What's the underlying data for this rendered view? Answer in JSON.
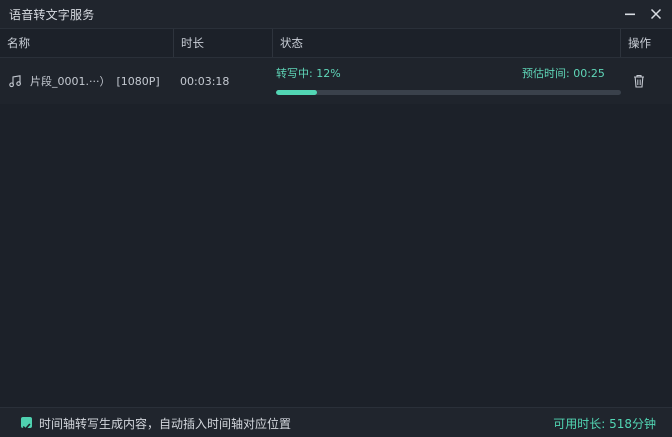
{
  "window": {
    "title": "语音转文字服务"
  },
  "table": {
    "headers": {
      "name": "名称",
      "duration": "时长",
      "status": "状态",
      "action": "操作"
    },
    "rows": [
      {
        "file_name": "片段_0001.···）",
        "resolution": "[1080P]",
        "duration": "00:03:18",
        "status_text": "转写中: 12%",
        "progress_percent": 12,
        "eta_label": "预估时间: 00:25"
      }
    ]
  },
  "footer": {
    "checkbox_checked": true,
    "checkbox_label": "时间轴转写生成内容，自动插入时间轴对应位置",
    "available_label": "可用时长: 518分钟"
  },
  "colors": {
    "accent": "#52d6b4",
    "background": "#1c2129"
  },
  "icons": {
    "file": "music-note-icon",
    "delete": "trash-icon",
    "minimize": "minimize-icon",
    "close": "close-icon",
    "check": "check-icon"
  }
}
